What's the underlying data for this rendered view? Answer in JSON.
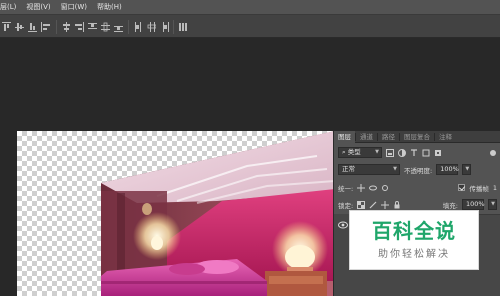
{
  "menubar": {
    "items": [
      "层(L)",
      "视图(V)",
      "窗口(W)",
      "帮助(H)"
    ]
  },
  "options_bar": {
    "icons": [
      "align-top-icon",
      "align-vcenter-icon",
      "align-bottom-icon",
      "align-left-icon",
      "align-hcenter-icon",
      "align-right-icon",
      "distribute-top-icon",
      "distribute-vcenter-icon",
      "distribute-bottom-icon",
      "distribute-left-icon",
      "distribute-hcenter-icon",
      "distribute-right-icon",
      "auto-align-icon"
    ]
  },
  "layers_panel": {
    "tabs": [
      "图层",
      "通道",
      "路径",
      "图层复合",
      "注释"
    ],
    "active_tab": "图层",
    "filter": {
      "label": "类型"
    },
    "blend_mode": "正常",
    "opacity_label": "不透明度:",
    "opacity_value": "100%",
    "unify_label": "统一:",
    "propagate_label": "传播帧",
    "propagate_value": "1",
    "lock_label": "锁定:",
    "fill_label": "填充:",
    "fill_value": "100%"
  },
  "watermark": {
    "title": "百科全说",
    "subtitle": "助你轻松解决"
  },
  "colors": {
    "menubar": "#535353",
    "options_bar": "#424242",
    "workspace": "#282828",
    "panel": "#535353",
    "watermark_green": "#1fa66a",
    "accent_pink": "#d0287a"
  }
}
